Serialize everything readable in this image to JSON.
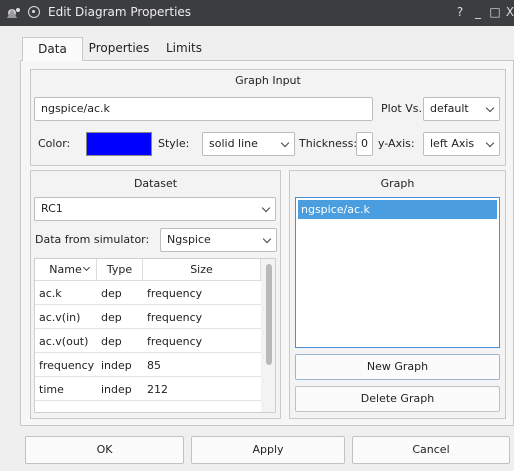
{
  "window": {
    "title": "Edit Diagram Properties"
  },
  "titlebar_buttons": {
    "help": "?",
    "minimize": "_",
    "maximize": "□",
    "close": "X"
  },
  "tabs": [
    {
      "label": "Data",
      "active": true
    },
    {
      "label": "Properties",
      "active": false
    },
    {
      "label": "Limits",
      "active": false
    }
  ],
  "graph_input": {
    "title": "Graph Input",
    "expression": "ngspice/ac.k",
    "plot_vs_label": "Plot Vs.",
    "plot_vs_value": "default",
    "color_label": "Color:",
    "color_value": "#0000ff",
    "style_label": "Style:",
    "style_value": "solid line",
    "thickness_label": "Thickness:",
    "thickness_value": "0",
    "yaxis_label": "y-Axis:",
    "yaxis_value": "left Axis"
  },
  "dataset": {
    "title": "Dataset",
    "selected": "RC1",
    "simulator_label": "Data from simulator:",
    "simulator_value": "Ngspice",
    "columns": [
      "Name",
      "Type",
      "Size"
    ],
    "rows": [
      {
        "name": "ac.k",
        "type": "dep",
        "size": "frequency"
      },
      {
        "name": "ac.v(in)",
        "type": "dep",
        "size": "frequency"
      },
      {
        "name": "ac.v(out)",
        "type": "dep",
        "size": "frequency"
      },
      {
        "name": "frequency",
        "type": "indep",
        "size": "85"
      },
      {
        "name": "time",
        "type": "indep",
        "size": "212"
      }
    ]
  },
  "graph": {
    "title": "Graph",
    "items": [
      "ngspice/ac.k"
    ],
    "new_label": "New Graph",
    "delete_label": "Delete Graph"
  },
  "footer": {
    "ok": "OK",
    "apply": "Apply",
    "cancel": "Cancel"
  }
}
